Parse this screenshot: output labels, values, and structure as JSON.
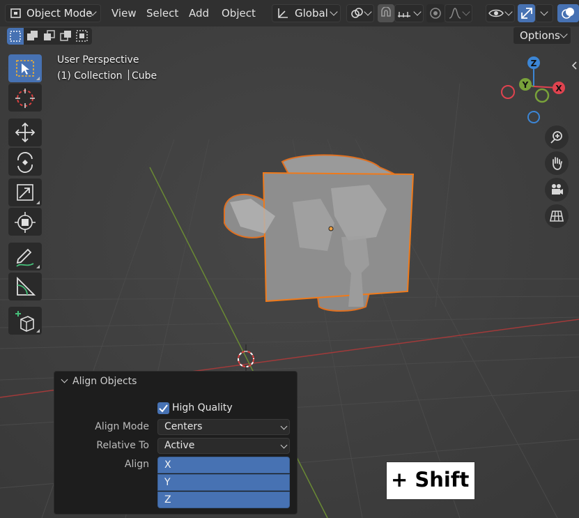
{
  "header": {
    "mode": "Object Mode",
    "menus": [
      "View",
      "Select",
      "Add",
      "Object"
    ],
    "orientation": "Global",
    "options": "Options"
  },
  "overlay": {
    "view_name": "User Perspective",
    "collection": "(1) Collection",
    "object": "Cube"
  },
  "gizmo": {
    "x": "X",
    "y": "Y",
    "z": "Z"
  },
  "panel": {
    "title": "Align Objects",
    "high_quality": "High Quality",
    "high_quality_checked": true,
    "align_mode_label": "Align Mode",
    "align_mode_value": "Centers",
    "relative_to_label": "Relative To",
    "relative_to_value": "Active",
    "align_label": "Align",
    "axes": [
      "X",
      "Y",
      "Z"
    ]
  },
  "key_hint": "+ Shift",
  "colors": {
    "accent": "#4772b3",
    "selection": "#f07a1a",
    "axis_x": "#e0434f",
    "axis_y": "#79a23a",
    "axis_z": "#3c86d6"
  },
  "icons": {
    "select_box": "select-box-icon",
    "cursor": "cursor-icon",
    "move": "move-icon",
    "rotate": "rotate-icon",
    "scale": "scale-icon",
    "transform": "transform-icon",
    "annotate": "annotate-icon",
    "measure": "measure-icon",
    "add_cube": "add-cube-icon",
    "zoom": "zoom-icon",
    "pan": "hand-icon",
    "camera": "camera-icon",
    "ortho": "grid-icon"
  }
}
